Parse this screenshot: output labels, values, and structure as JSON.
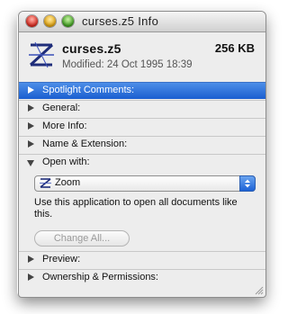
{
  "window": {
    "title": "curses.z5 Info"
  },
  "file": {
    "name": "curses.z5",
    "size": "256 KB",
    "modified": "Modified: 24 Oct 1995 18:39",
    "icon": "z5-file-icon"
  },
  "sections": [
    {
      "label": "Spotlight Comments:",
      "state": "collapsed",
      "selected": true
    },
    {
      "label": "General:",
      "state": "collapsed"
    },
    {
      "label": "More Info:",
      "state": "collapsed"
    },
    {
      "label": "Name & Extension:",
      "state": "collapsed"
    },
    {
      "label": "Open with:",
      "state": "expanded"
    },
    {
      "label": "Preview:",
      "state": "collapsed"
    },
    {
      "label": "Ownership & Permissions:",
      "state": "collapsed"
    }
  ],
  "open_with": {
    "selected_app": "Zoom",
    "app_icon": "zoom-app-icon",
    "help_text": "Use this application to open all documents like this.",
    "change_all_label": "Change All..."
  },
  "colors": {
    "selection": "#1a5ed0",
    "window_bg": "#ededed"
  }
}
